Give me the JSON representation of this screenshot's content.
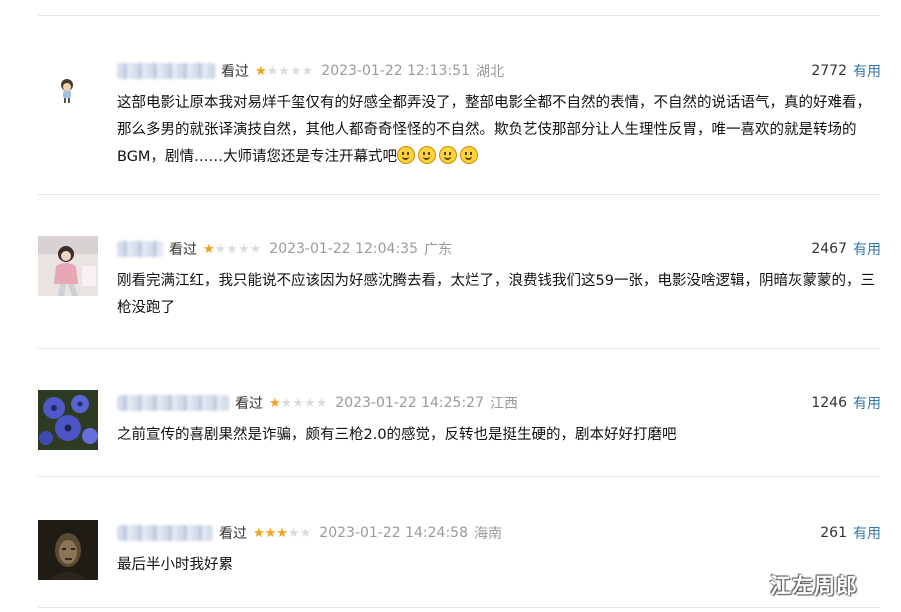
{
  "comments": [
    {
      "watched_label": "看过",
      "rating": 1,
      "time": "2023-01-22 12:13:51",
      "location": "湖北",
      "votes": "2772",
      "useful_label": "有用",
      "text": "这部电影让原本我对易烊千玺仅有的好感全都弄没了，整部电影全都不自然的表情，不自然的说话语气，真的好难看，那么多男的就张译演技自然，其他人都奇奇怪怪的不自然。欺负艺伎那部分让人生理性反胃，唯一喜欢的就是转场的BGM，剧情……大师请您还是专注开幕式吧",
      "emoji_count": 4
    },
    {
      "watched_label": "看过",
      "rating": 1,
      "time": "2023-01-22 12:04:35",
      "location": "广东",
      "votes": "2467",
      "useful_label": "有用",
      "text": "刚看完满江红，我只能说不应该因为好感沈腾去看，太烂了，浪费钱我们这59一张，电影没啥逻辑，阴暗灰蒙蒙的，三枪没跑了"
    },
    {
      "watched_label": "看过",
      "rating": 1,
      "time": "2023-01-22 14:25:27",
      "location": "江西",
      "votes": "1246",
      "useful_label": "有用",
      "text": "之前宣传的喜剧果然是诈骗，颇有三枪2.0的感觉，反转也是挺生硬的，剧本好好打磨吧"
    },
    {
      "watched_label": "看过",
      "rating": 3,
      "time": "2023-01-22 14:24:58",
      "location": "海南",
      "votes": "261",
      "useful_label": "有用",
      "text": "最后半小时我好累"
    }
  ],
  "colors": {
    "star": "#f4a21d",
    "useful_link": "#3377aa",
    "meta_gray": "#9a9a9a"
  },
  "watermark": "江左周郎"
}
